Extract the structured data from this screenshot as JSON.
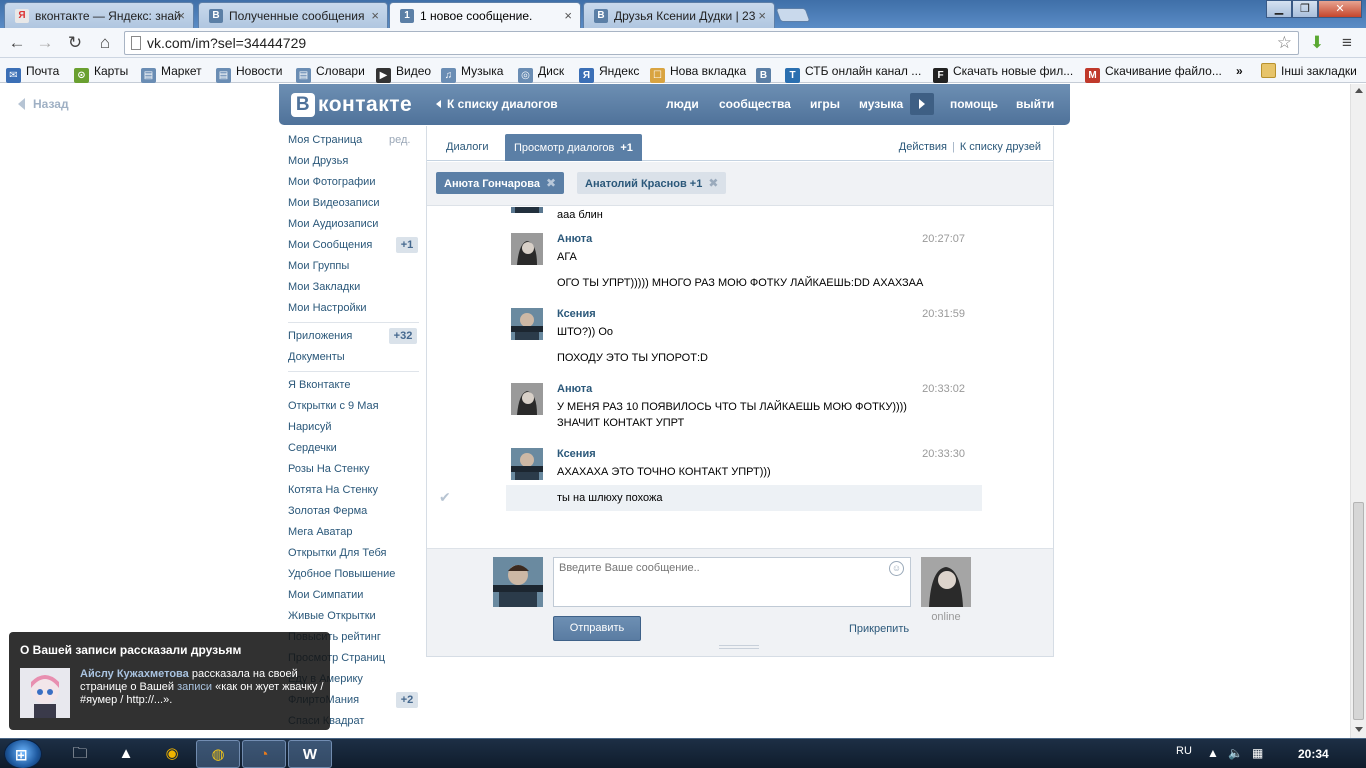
{
  "browser": {
    "tabs": [
      {
        "label": "вконтакте — Яндекс: знай",
        "icon_text": "Я",
        "icon_color": "#e8e8e8",
        "icon_fg": "#d33",
        "active": false
      },
      {
        "label": "Полученные сообщения",
        "icon_text": "B",
        "icon_color": "#5b7fa6",
        "icon_fg": "#ffffff",
        "active": false
      },
      {
        "label": "1 новое сообщение.",
        "icon_text": "1",
        "icon_color": "#5b7fa6",
        "icon_fg": "#ffffff",
        "active": true
      },
      {
        "label": "Друзья Ксении Дудки | 23",
        "icon_text": "B",
        "icon_color": "#5b7fa6",
        "icon_fg": "#ffffff",
        "active": false
      }
    ],
    "url": "vk.com/im?sel=34444729",
    "bookmarks": [
      {
        "label": "Почта",
        "icon_color": "#3b6fb6"
      },
      {
        "label": "Карты",
        "icon_color": "#6aa030"
      },
      {
        "label": "Маркет",
        "icon_color": "#6a8db4"
      },
      {
        "label": "Новости",
        "icon_color": "#6a8db4"
      },
      {
        "label": "Словари",
        "icon_color": "#6a8db4"
      },
      {
        "label": "Видео",
        "icon_color": "#333333"
      },
      {
        "label": "Музыка",
        "icon_color": "#6a8db4"
      },
      {
        "label": "Диск",
        "icon_color": "#6a8db4"
      },
      {
        "label": "Яндекс",
        "icon_color": "#3b6fb6"
      },
      {
        "label": "Нова вкладка",
        "icon_color": "#d9a441"
      },
      {
        "label": "",
        "icon_color": "#5b7fa6"
      },
      {
        "label": "СТБ онлайн канал ...",
        "icon_color": "#2a6fb0"
      },
      {
        "label": "Скачать новые фил...",
        "icon_color": "#222222"
      },
      {
        "label": "Скачивание файло...",
        "icon_color": "#c0392b"
      }
    ],
    "other_bookmarks": "Інші закладки"
  },
  "page": {
    "back_label": "Назад",
    "logo_text": "контакте",
    "logo_letter": "В",
    "header_back": "К списку диалогов",
    "nav": [
      "люди",
      "сообщества",
      "игры",
      "музыка",
      "помощь",
      "выйти"
    ],
    "left_menu": {
      "edit_label": "ред.",
      "group1": [
        {
          "label": "Моя Страница"
        },
        {
          "label": "Мои Друзья"
        },
        {
          "label": "Мои Фотографии"
        },
        {
          "label": "Мои Видеозаписи"
        },
        {
          "label": "Мои Аудиозаписи"
        },
        {
          "label": "Мои Сообщения",
          "count": "+1"
        },
        {
          "label": "Мои Группы"
        },
        {
          "label": "Мои Закладки"
        },
        {
          "label": "Мои Настройки"
        }
      ],
      "group2": [
        {
          "label": "Приложения",
          "count": "+32"
        },
        {
          "label": "Документы"
        }
      ],
      "group3": [
        {
          "label": "Я Вконтакте"
        },
        {
          "label": "Открытки с 9 Мая"
        },
        {
          "label": "Нарисуй"
        },
        {
          "label": "Сердечки"
        },
        {
          "label": "Розы На Стенку"
        },
        {
          "label": "Котята На Стенку"
        },
        {
          "label": "Золотая Ферма"
        },
        {
          "label": "Мега Аватар"
        },
        {
          "label": "Открытки Для Тебя"
        },
        {
          "label": "Удобное Повышение"
        },
        {
          "label": "Мои Симпатии"
        },
        {
          "label": "Живые Открытки"
        },
        {
          "label": "Повысить рейтинг"
        },
        {
          "label": "Просмотр Страниц"
        },
        {
          "label": "Еду в Америку"
        },
        {
          "label": "ФлиртоМания",
          "count": "+2"
        },
        {
          "label": "Спаси Квадрат"
        }
      ]
    },
    "dialog_tabs": {
      "dialogs": "Диалоги",
      "view": "Просмотр диалогов",
      "view_count": "+1",
      "actions": "Действия",
      "friends_list": "К списку друзей"
    },
    "peer_tabs": [
      {
        "label": "Анюта Гончарова",
        "active": true
      },
      {
        "label": "Анатолий Краснов +1",
        "active": false
      }
    ],
    "messages": [
      {
        "author": "",
        "time": "",
        "lines": [
          "ааа блин"
        ]
      },
      {
        "author": "Анюта",
        "time": "20:27:07",
        "lines": [
          "АГА",
          "ОГО ТЫ УПРТ))))) МНОГО РАЗ МОЮ ФОТКУ ЛАЙКАЕШЬ:DD АХАХЗАА"
        ]
      },
      {
        "author": "Ксения",
        "time": "20:31:59",
        "lines": [
          "ШТО?)) Оо",
          "ПОХОДУ ЭТО ТЫ УПОРОТ:D"
        ]
      },
      {
        "author": "Анюта",
        "time": "20:33:02",
        "lines": [
          "У МЕНЯ РАЗ 10 ПОЯВИЛОСЬ ЧТО ТЫ ЛАЙКАЕШЬ МОЮ ФОТКУ))))",
          "ЗНАЧИТ КОНТАКТ УПРТ"
        ]
      },
      {
        "author": "Ксения",
        "time": "20:33:30",
        "lines": [
          "АХАХАХА ЭТО ТОЧНО КОНТАКТ УПРТ)))"
        ]
      },
      {
        "author": "",
        "time": "",
        "lines": [
          "ты на шлюху похожа"
        ]
      }
    ],
    "composer": {
      "placeholder": "Введите Ваше сообщение..",
      "send": "Отправить",
      "attach": "Прикрепить",
      "online": "online"
    },
    "notification": {
      "title": "О Вашей записи рассказали друзьям",
      "actor": "Айслу Кужахметова",
      "text1": " рассказала на своей странице о Вашей ",
      "link": "записи",
      "text2": " «как он жует жвачку / #яумер / http://...»."
    }
  },
  "taskbar": {
    "lang": "RU",
    "clock": "20:34"
  }
}
